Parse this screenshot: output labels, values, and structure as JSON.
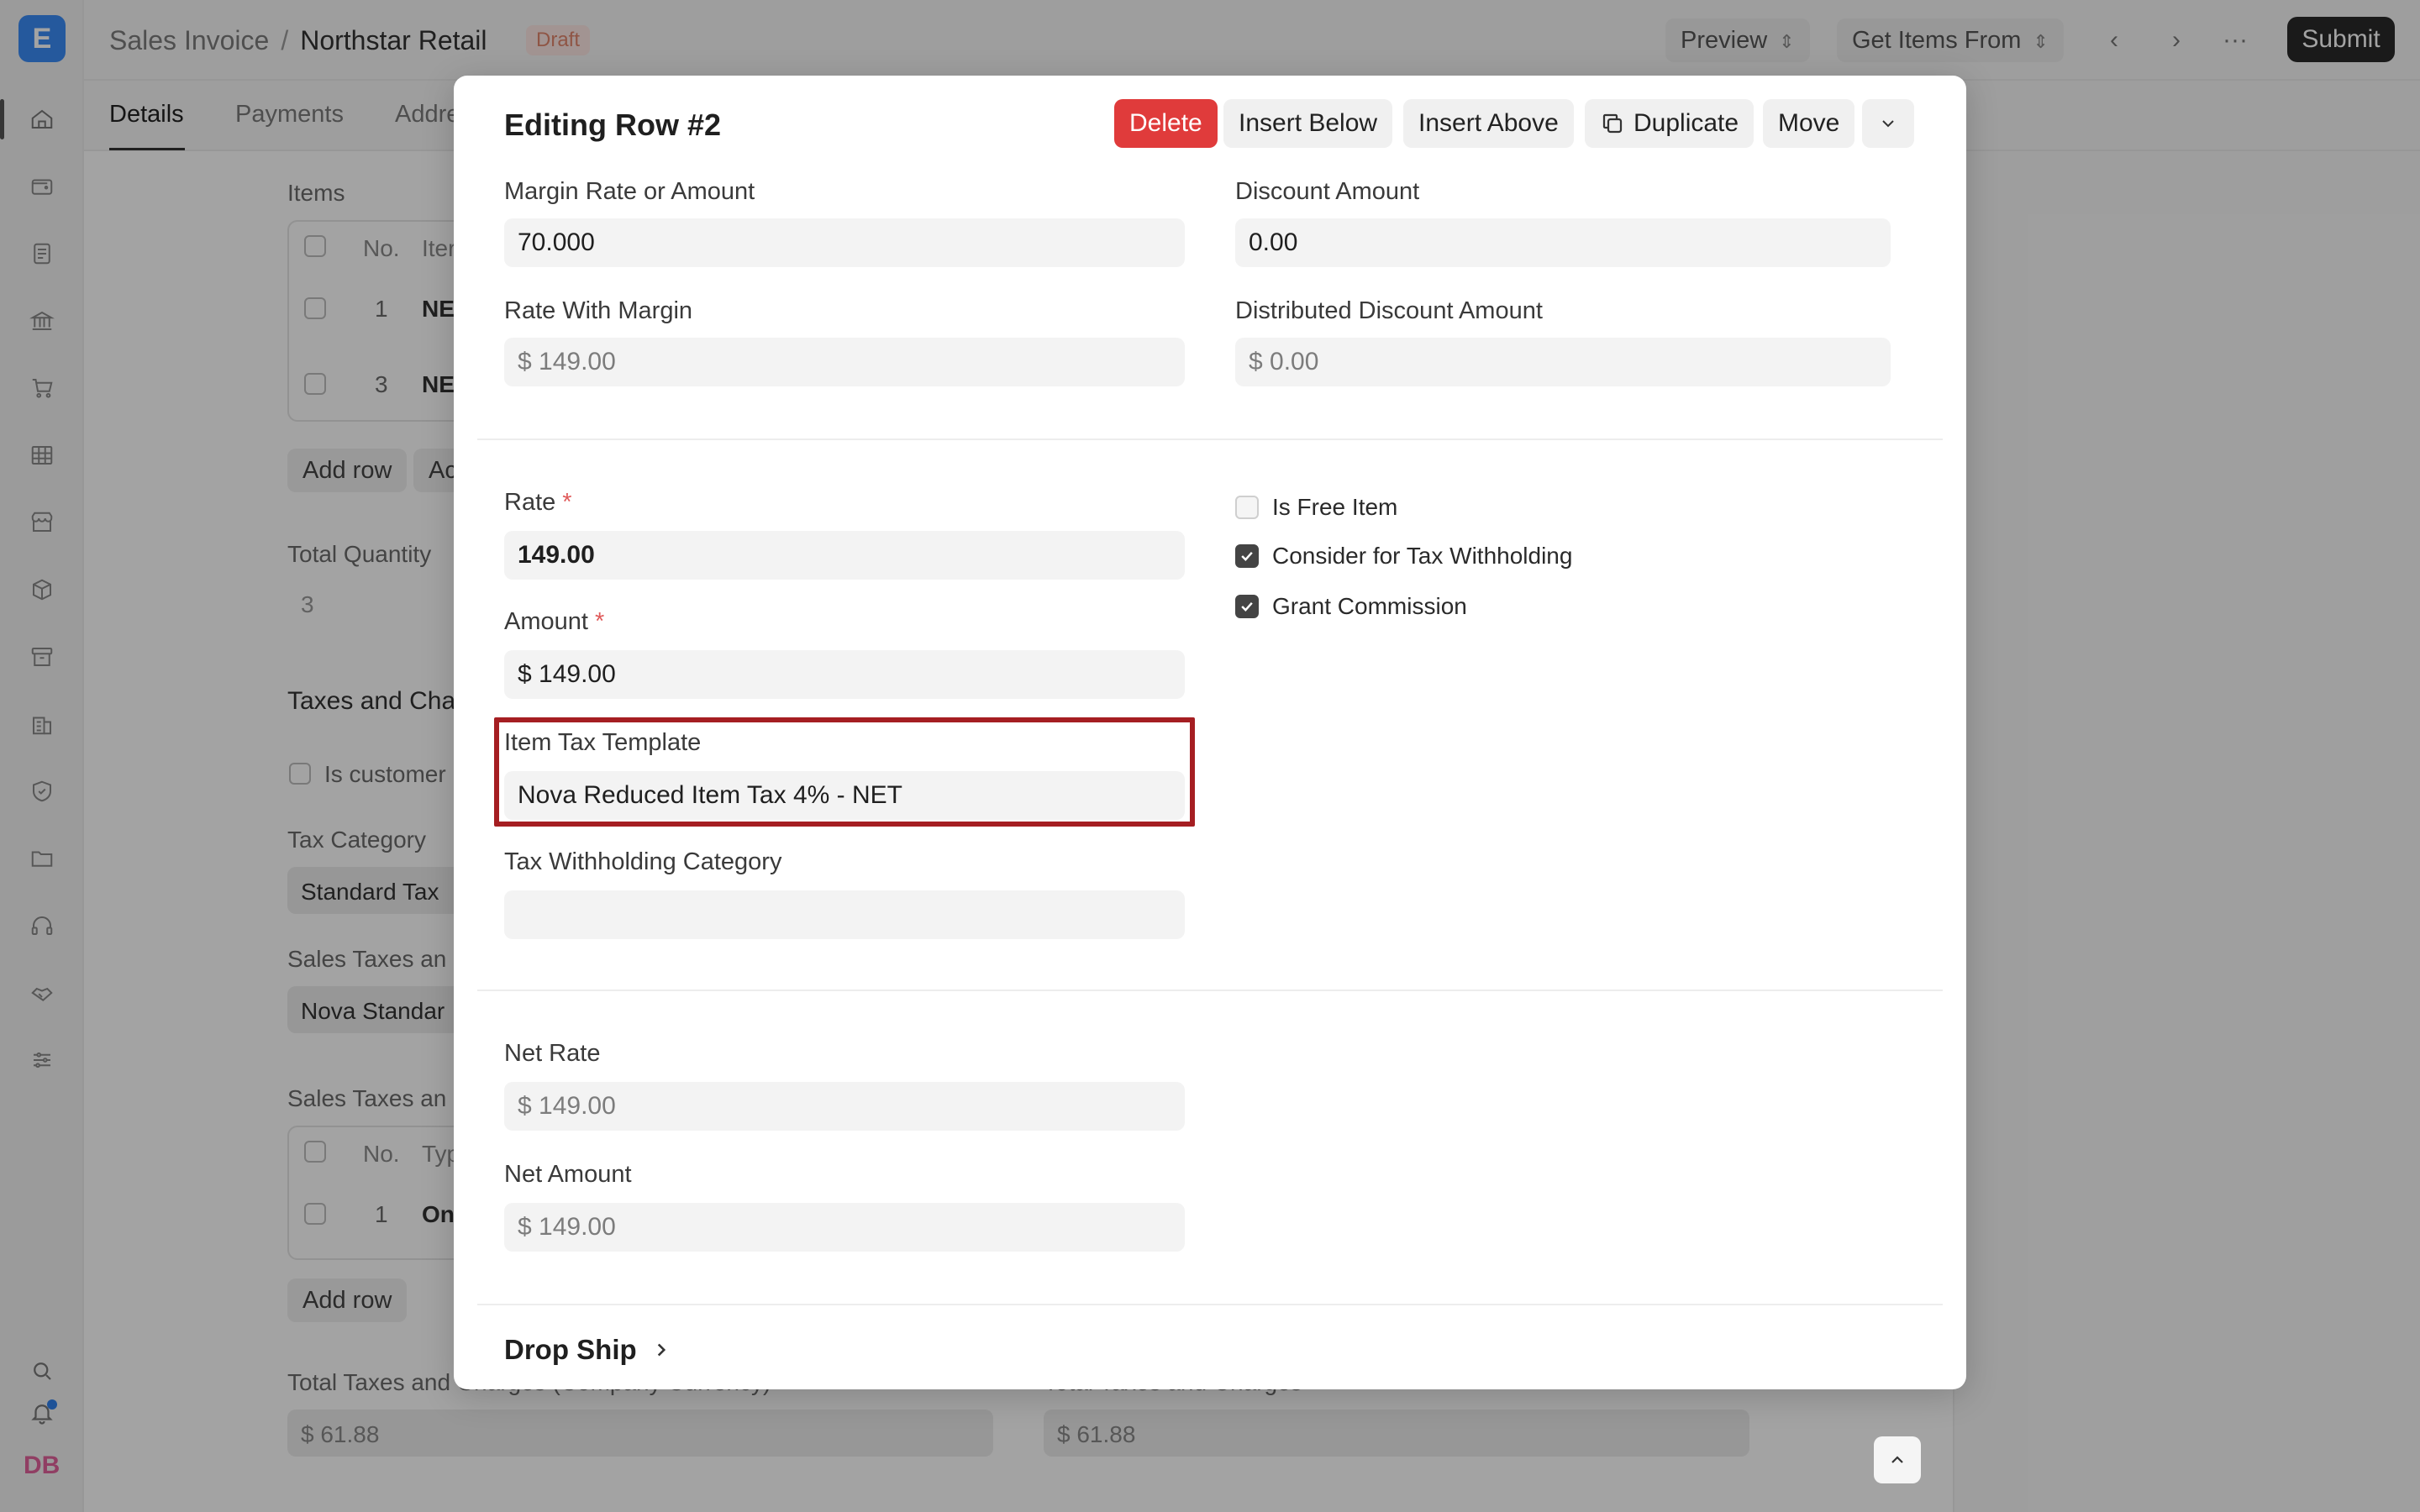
{
  "app": {
    "logo_letter": "E",
    "user_initials": "DB"
  },
  "breadcrumb": {
    "doctype": "Sales Invoice",
    "separator": "/",
    "document": "Northstar Retail",
    "status": "Draft"
  },
  "toolbar": {
    "preview": "Preview",
    "get_items": "Get Items From",
    "more": "···",
    "submit": "Submit"
  },
  "tabs": [
    "Details",
    "Payments",
    "Addre"
  ],
  "background": {
    "items_label": "Items",
    "items_table": {
      "col_no": "No.",
      "col_item": "Iter",
      "rows": [
        {
          "no": "1",
          "item": "NE"
        },
        {
          "no": "3",
          "item": "NE"
        }
      ]
    },
    "add_row": "Add row",
    "add_row_2": "Ac",
    "total_qty_label": "Total Quantity",
    "total_qty_value": "3",
    "taxes_header": "Taxes and Char",
    "is_customer": "Is customer",
    "tax_category_label": "Tax Category",
    "tax_category_value": "Standard Tax",
    "sales_taxes_template_label": "Sales Taxes an",
    "sales_taxes_template_value": "Nova Standar",
    "sales_taxes_table_label": "Sales Taxes an",
    "taxes_table": {
      "col_no": "No.",
      "col_type": "Typ",
      "rows": [
        {
          "no": "1",
          "type": "On"
        }
      ]
    },
    "add_row_3": "Add row",
    "total_taxes_company_label": "Total Taxes and Charges (Company Currency)",
    "total_taxes_company_value": "$ 61.88",
    "total_taxes_label": "Total Taxes and Charges",
    "total_taxes_value": "$ 61.88"
  },
  "modal": {
    "title": "Editing Row #2",
    "actions": {
      "delete": "Delete",
      "insert_below": "Insert Below",
      "insert_above": "Insert Above",
      "duplicate": "Duplicate",
      "move": "Move"
    },
    "fields": {
      "margin_rate": {
        "label": "Margin Rate or Amount",
        "value": "70.000"
      },
      "discount_amount": {
        "label": "Discount Amount",
        "value": "0.00"
      },
      "rate_with_margin": {
        "label": "Rate With Margin",
        "value": "$ 149.00"
      },
      "distributed_discount": {
        "label": "Distributed Discount Amount",
        "value": "$ 0.00"
      },
      "rate": {
        "label": "Rate",
        "required": "*",
        "value": "149.00"
      },
      "amount": {
        "label": "Amount",
        "required": "*",
        "value": "$ 149.00"
      },
      "item_tax_template": {
        "label": "Item Tax Template",
        "value": "Nova Reduced Item Tax 4% - NET"
      },
      "tax_withholding_category": {
        "label": "Tax Withholding Category",
        "value": ""
      },
      "net_rate": {
        "label": "Net Rate",
        "value": "$ 149.00"
      },
      "net_amount": {
        "label": "Net Amount",
        "value": "$ 149.00"
      }
    },
    "checkboxes": [
      {
        "label": "Is Free Item",
        "checked": false
      },
      {
        "label": "Consider for Tax Withholding",
        "checked": true
      },
      {
        "label": "Grant Commission",
        "checked": true
      }
    ],
    "drop_ship": "Drop Ship"
  },
  "colors": {
    "danger": "#e03b3b",
    "highlight": "#a51e22",
    "accent": "#3b8bf6"
  }
}
